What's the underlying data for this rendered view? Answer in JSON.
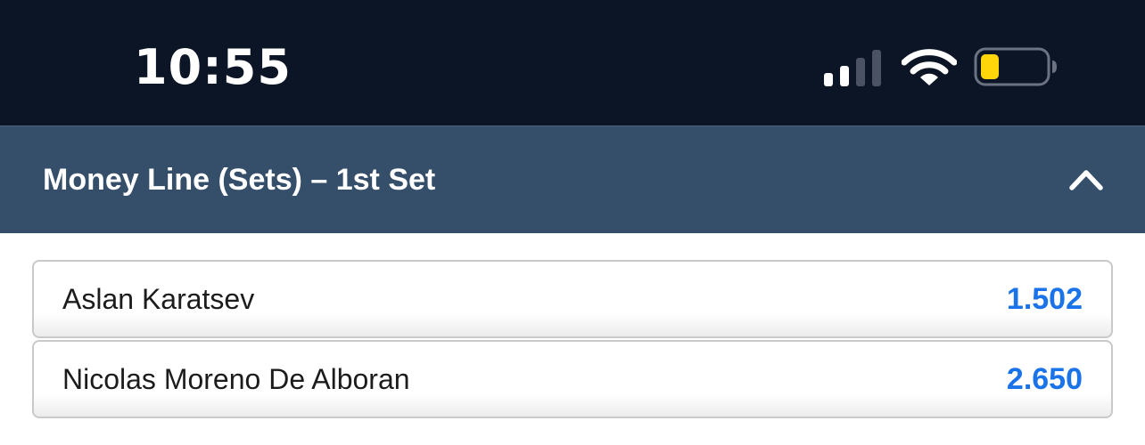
{
  "status_bar": {
    "time": "10:55",
    "icons": [
      "signal-icon",
      "wifi-icon",
      "battery-icon"
    ],
    "battery_fill_color": "#ffd60a"
  },
  "market": {
    "title": "Money Line (Sets) – 1st Set",
    "collapse_icon": "chevron-up-icon",
    "selections": [
      {
        "name": "Aslan Karatsev",
        "odds": "1.502"
      },
      {
        "name": "Nicolas Moreno De Alboran",
        "odds": "2.650"
      }
    ]
  },
  "colors": {
    "status_bar_bg": "#0c1526",
    "header_bg": "#354f6a",
    "odds_blue": "#1a73e8"
  }
}
